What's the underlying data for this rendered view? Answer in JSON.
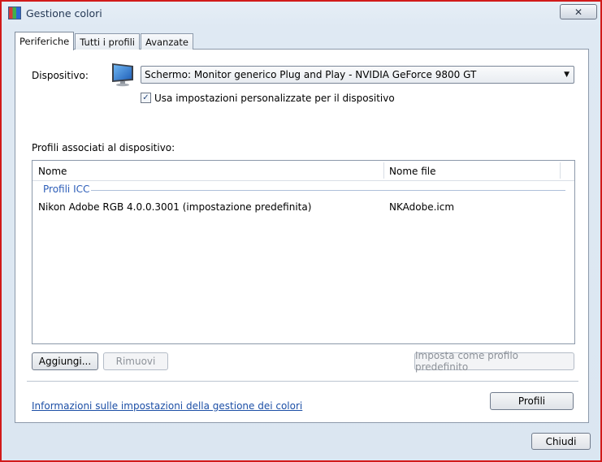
{
  "window": {
    "title": "Gestione colori",
    "close_symbol": "✕",
    "accent_border": "#d11a1a"
  },
  "tabs": [
    {
      "label": "Periferiche",
      "active": true
    },
    {
      "label": "Tutti i profili",
      "active": false
    },
    {
      "label": "Avanzate",
      "active": false
    }
  ],
  "device": {
    "label": "Dispositivo:",
    "icon": "monitor-icon",
    "selected": "Schermo: Monitor generico Plug and Play - NVIDIA GeForce 9800 GT",
    "custom_settings_label": "Usa impostazioni personalizzate per il dispositivo",
    "custom_settings_checked": true
  },
  "profiles": {
    "label": "Profili associati al dispositivo:",
    "columns": [
      "Nome",
      "Nome file"
    ],
    "group": "Profili ICC",
    "rows": [
      {
        "name": "Nikon Adobe RGB 4.0.0.3001 (impostazione predefinita)",
        "file": "NKAdobe.icm"
      }
    ]
  },
  "buttons": {
    "add": "Aggiungi...",
    "remove": "Rimuovi",
    "set_default": "Imposta come profilo predefinito",
    "profiles": "Profili",
    "close": "Chiudi"
  },
  "link_text": "Informazioni sulle impostazioni della gestione dei colori"
}
